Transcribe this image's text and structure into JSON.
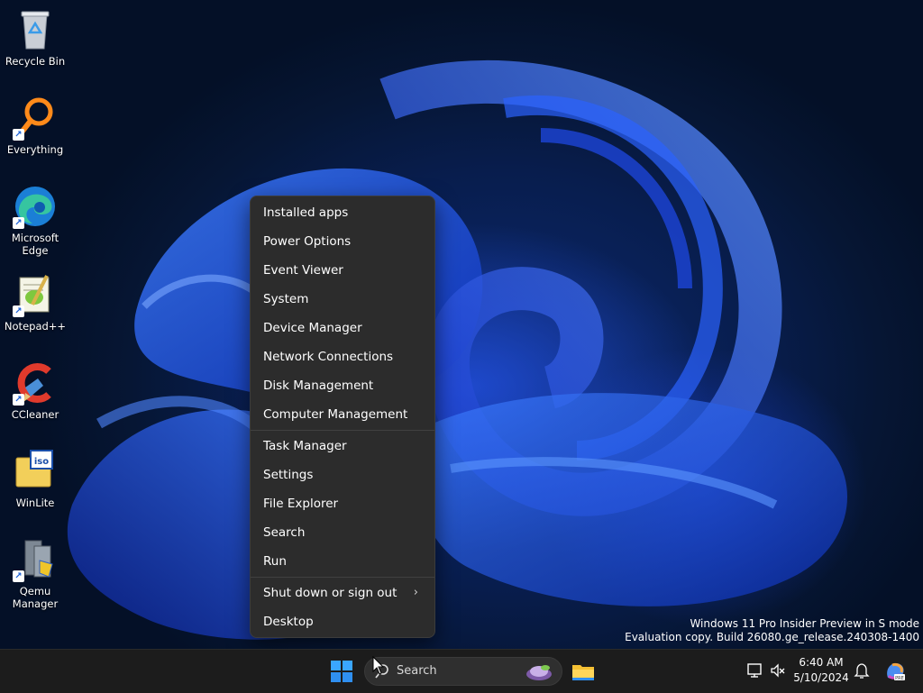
{
  "desktop_icons": [
    {
      "label": "Recycle Bin",
      "icon": "recycle-bin-icon"
    },
    {
      "label": "Everything",
      "icon": "everything-search-icon"
    },
    {
      "label": "Microsoft\nEdge",
      "icon": "edge-icon"
    },
    {
      "label": "Notepad++",
      "icon": "notepadpp-icon"
    },
    {
      "label": "CCleaner",
      "icon": "ccleaner-icon"
    },
    {
      "label": "WinLite",
      "icon": "winlite-icon"
    },
    {
      "label": "Qemu\nManager",
      "icon": "qemu-manager-icon"
    }
  ],
  "context_menu": {
    "group1": [
      "Installed apps",
      "Power Options",
      "Event Viewer",
      "System",
      "Device Manager",
      "Network Connections",
      "Disk Management",
      "Computer Management"
    ],
    "group2": [
      "Task Manager",
      "Settings",
      "File Explorer",
      "Search",
      "Run"
    ],
    "group3": [
      "Shut down or sign out",
      "Desktop"
    ],
    "submenu_arrow": "›"
  },
  "watermark": {
    "line1": "Windows 11 Pro Insider Preview in S mode",
    "line2": "Evaluation copy. Build 26080.ge_release.240308-1400"
  },
  "taskbar": {
    "search_placeholder": "Search",
    "time": "6:40 AM",
    "date": "5/10/2024"
  },
  "colors": {
    "accent": "#2f6ce8",
    "menu_bg": "#2c2c2c",
    "taskbar_bg": "#1c1c1c"
  }
}
